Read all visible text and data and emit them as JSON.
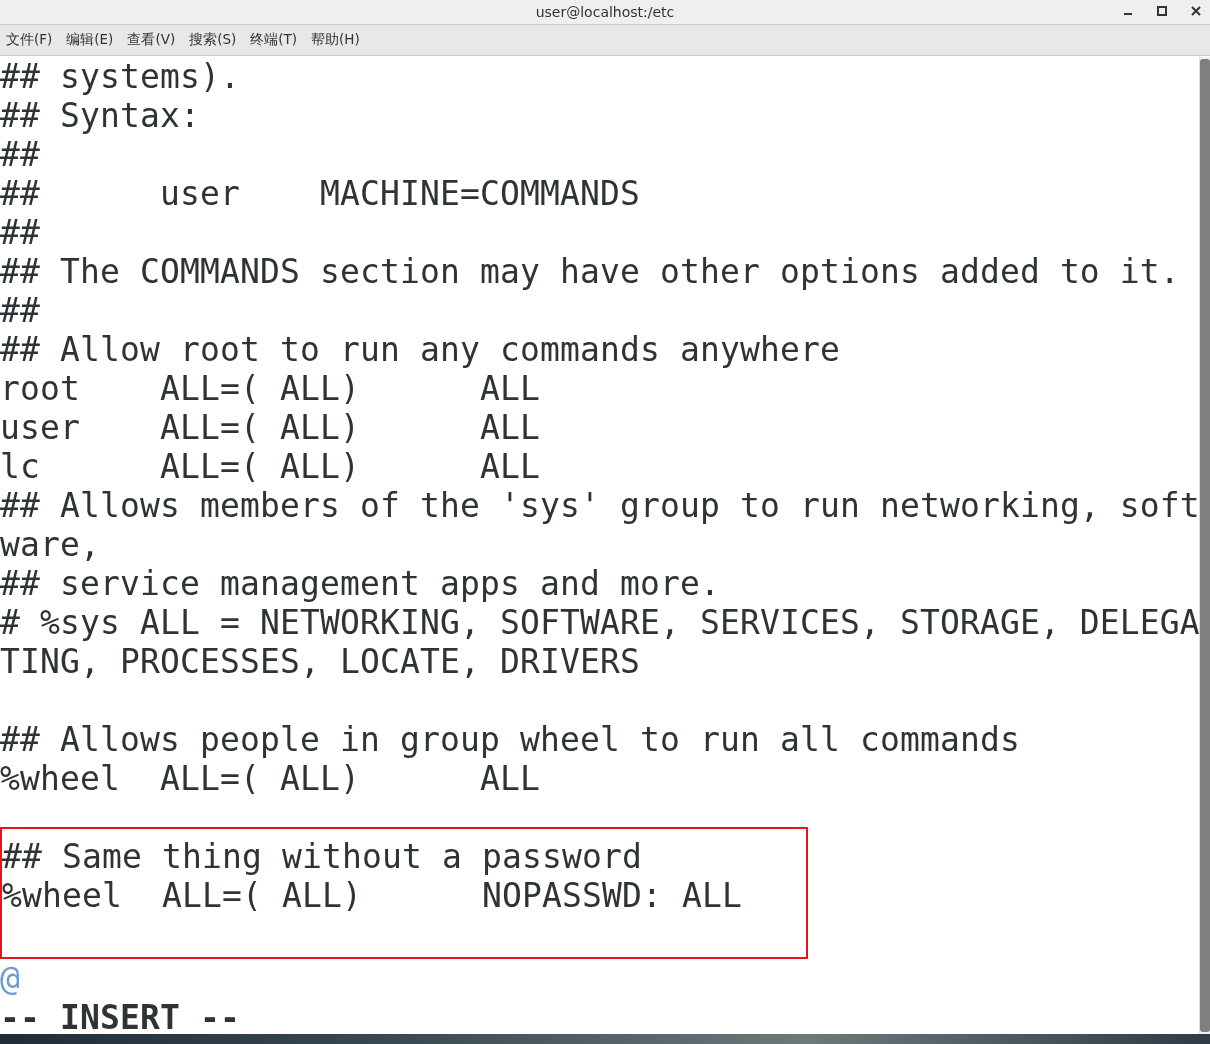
{
  "window": {
    "title": "user@localhost:/etc"
  },
  "menu": [
    {
      "label": "文件(F)"
    },
    {
      "label": "编辑(E)"
    },
    {
      "label": "查看(V)"
    },
    {
      "label": "搜索(S)"
    },
    {
      "label": "终端(T)"
    },
    {
      "label": "帮助(H)"
    }
  ],
  "buffer": [
    {
      "kind": "text",
      "text": "## systems)."
    },
    {
      "kind": "text",
      "text": "## Syntax:"
    },
    {
      "kind": "text",
      "text": "##"
    },
    {
      "kind": "text",
      "text": "##      user    MACHINE=COMMANDS"
    },
    {
      "kind": "text",
      "text": "##"
    },
    {
      "kind": "text",
      "text": "## The COMMANDS section may have other options added to it."
    },
    {
      "kind": "text",
      "text": "##"
    },
    {
      "kind": "text",
      "text": "## Allow root to run any commands anywhere"
    },
    {
      "kind": "text",
      "text": "root    ALL=( ALL)      ALL"
    },
    {
      "kind": "text",
      "text": "user    ALL=( ALL)      ALL"
    },
    {
      "kind": "text",
      "text": "lc      ALL=( ALL)      ALL"
    },
    {
      "kind": "text",
      "text": "## Allows members of the 'sys' group to run networking, soft"
    },
    {
      "kind": "text",
      "text": "ware,"
    },
    {
      "kind": "text",
      "text": "## service management apps and more."
    },
    {
      "kind": "text",
      "text": "# %sys ALL = NETWORKING, SOFTWARE, SERVICES, STORAGE, DELEGA"
    },
    {
      "kind": "text",
      "text": "TING, PROCESSES, LOCATE, DRIVERS"
    },
    {
      "kind": "blank"
    },
    {
      "kind": "text",
      "text": "## Allows people in group wheel to run all commands"
    },
    {
      "kind": "text",
      "text": "%wheel  ALL=( ALL)      ALL"
    },
    {
      "kind": "blank"
    },
    {
      "kind": "highlight",
      "lines": [
        {
          "kind": "text",
          "text": "## Same thing without a password"
        },
        {
          "kind": "text",
          "text": "%wheel  ALL=( ALL)      NOPASSWD: ALL"
        },
        {
          "kind": "blank"
        }
      ]
    },
    {
      "kind": "filler",
      "text": "@"
    }
  ],
  "status_line": {
    "mode": "-- INSERT --"
  }
}
